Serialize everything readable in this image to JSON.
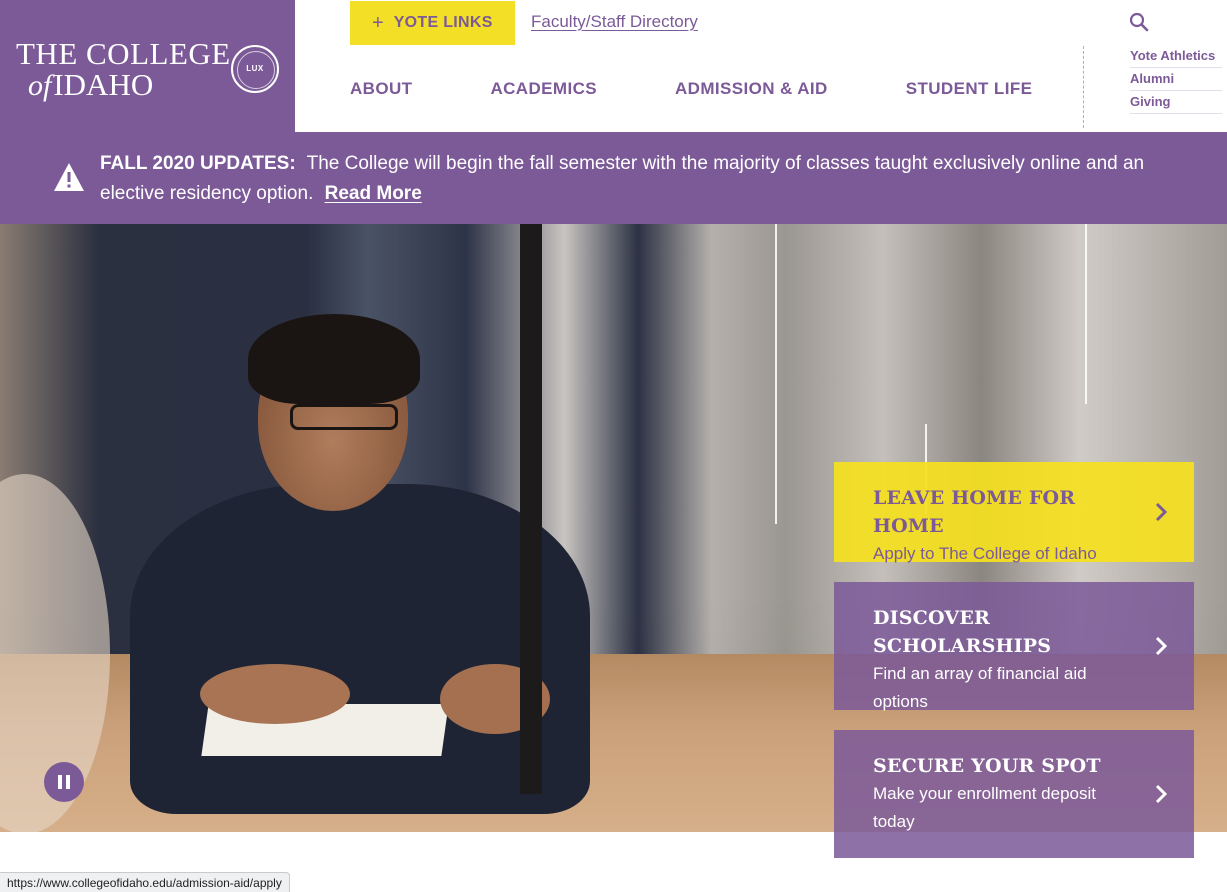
{
  "logo": {
    "line1": "THE COLLEGE",
    "of": "of",
    "line2": "IDAHO",
    "seal_text": "LUX"
  },
  "top_bar": {
    "vote_links_label": "YOTE LINKS",
    "vote_links_icon": "plus-icon",
    "faculty_directory": "Faculty/Staff Directory",
    "search_icon": "search-icon"
  },
  "main_nav": [
    {
      "label": "ABOUT"
    },
    {
      "label": "ACADEMICS"
    },
    {
      "label": "ADMISSION & AID"
    },
    {
      "label": "STUDENT LIFE"
    }
  ],
  "side_links": [
    {
      "label": "Yote Athletics"
    },
    {
      "label": "Alumni"
    },
    {
      "label": "Giving"
    }
  ],
  "alert": {
    "icon": "warning-icon",
    "title": "FALL 2020 UPDATES:",
    "message": "The College will begin the fall semester with the majority of classes taught exclusively online and an elective residency option.",
    "link": "Read More"
  },
  "hero": {
    "pause_icon": "pause-icon"
  },
  "cta_cards": [
    {
      "title": "LEAVE HOME FOR HOME",
      "subtitle": "Apply to The College of Idaho"
    },
    {
      "title": "DISCOVER SCHOLARSHIPS",
      "subtitle": "Find an array of financial aid options"
    },
    {
      "title": "SECURE YOUR SPOT",
      "subtitle": "Make your enrollment deposit today"
    }
  ],
  "status_bar": {
    "url": "https://www.collegeofidaho.edu/admission-aid/apply"
  },
  "colors": {
    "brand_purple": "#7c5a98",
    "brand_yellow": "#f3df25",
    "white": "#ffffff"
  }
}
